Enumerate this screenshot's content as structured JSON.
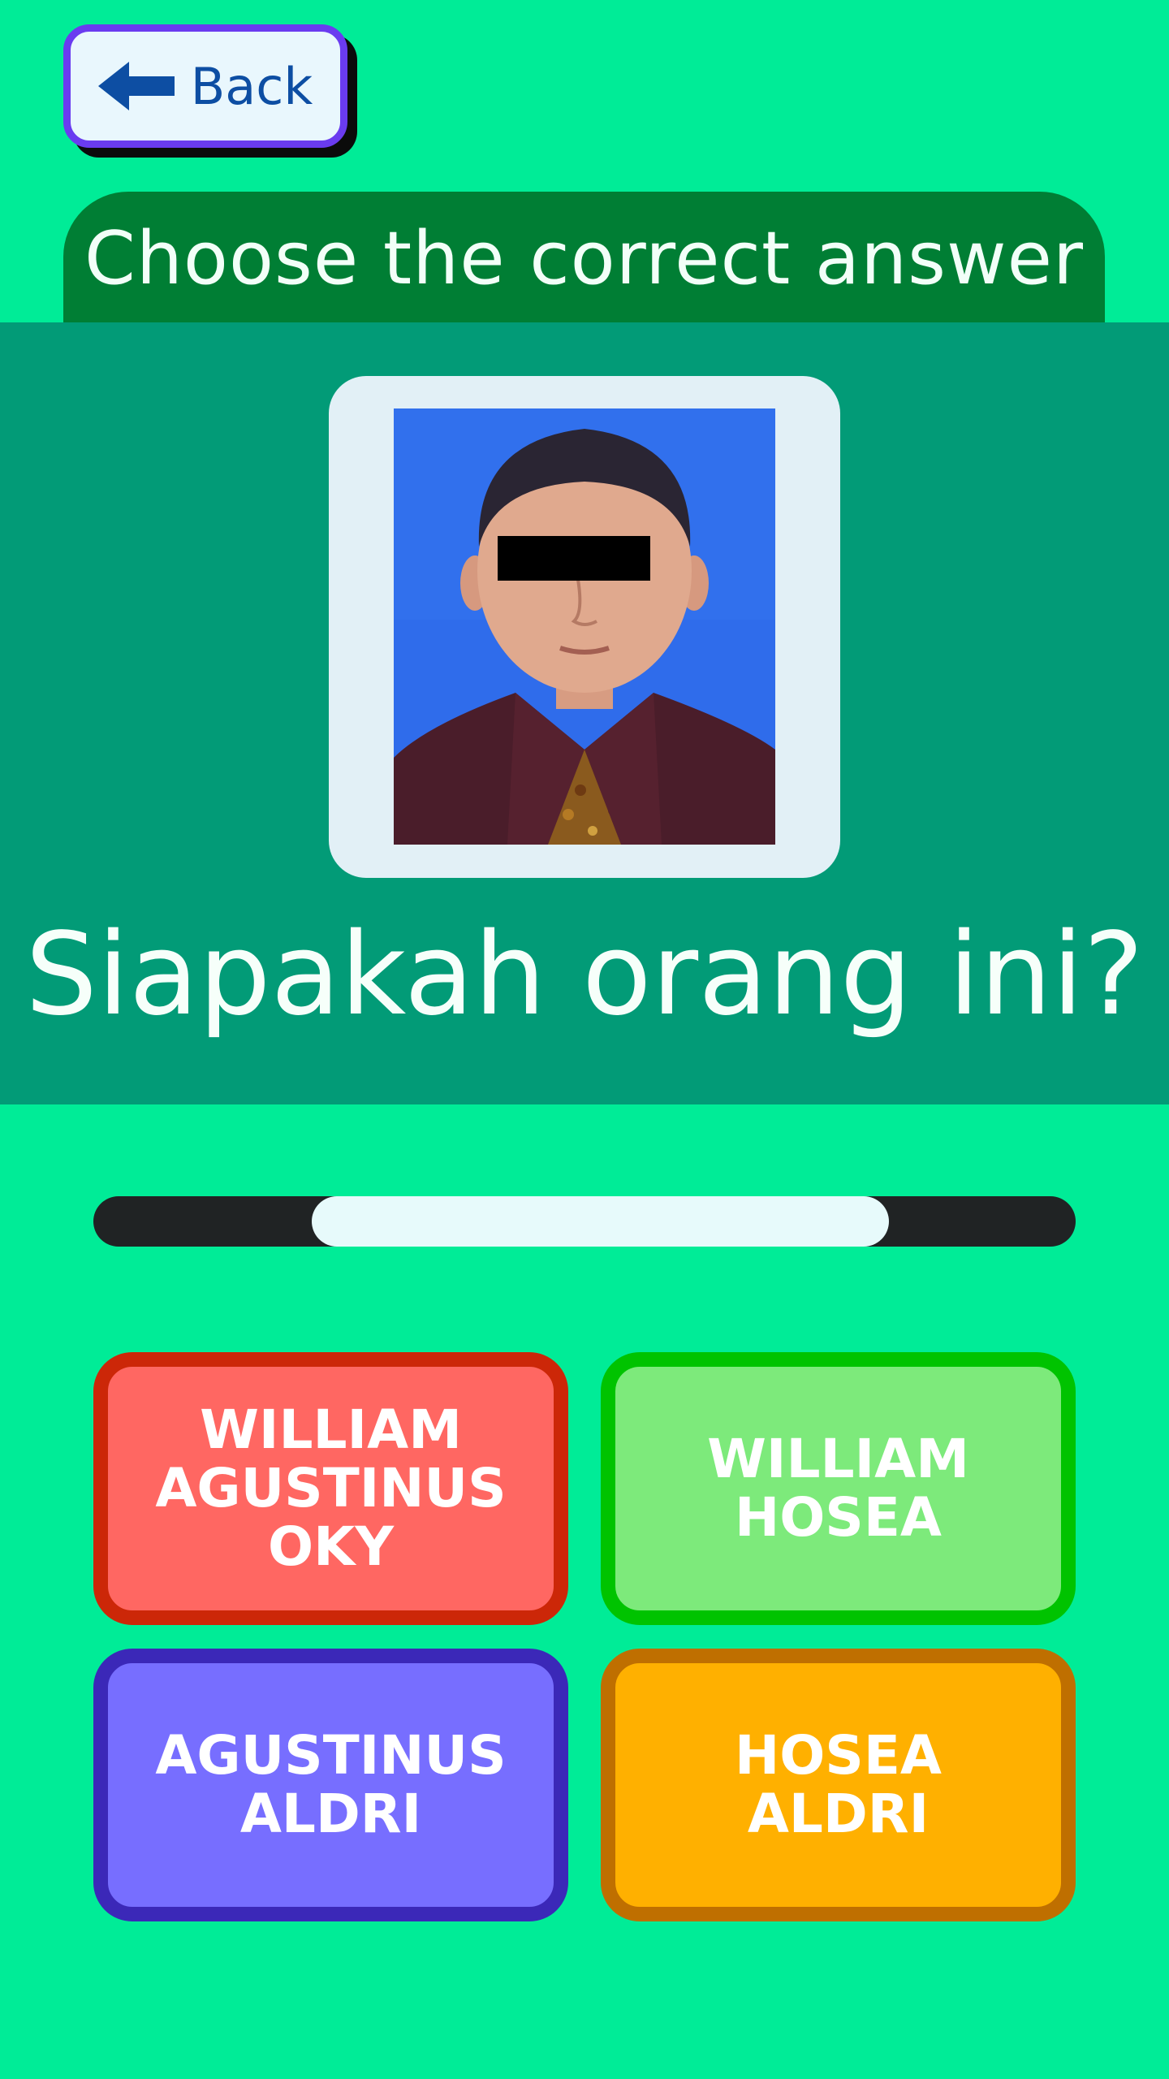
{
  "back_button": {
    "label": "Back",
    "icon": "arrow-left-icon"
  },
  "header": {
    "title": "Choose the correct answer"
  },
  "question": {
    "text": "Siapakah orang ini?"
  },
  "progress": {
    "start_fraction": 0.222,
    "end_fraction": 0.81
  },
  "answers": [
    {
      "label": "WILLIAM\nAGUSTINUS\nOKY",
      "fill": "#FF6762",
      "border": "#CC2708"
    },
    {
      "label": "WILLIAM\nHOSEA",
      "fill": "#7DEA7B",
      "border": "#00C300"
    },
    {
      "label": "AGUSTINUS\nALDRI",
      "fill": "#776EFF",
      "border": "#3B28B8"
    },
    {
      "label": "HOSEA\nALDRI",
      "fill": "#FFB000",
      "border": "#BF6F00"
    }
  ],
  "colors": {
    "background": "#00EC97",
    "header": "#007E34",
    "panel": "#029B77",
    "progress_track": "#202324",
    "progress_fill": "#E7FAFB"
  }
}
